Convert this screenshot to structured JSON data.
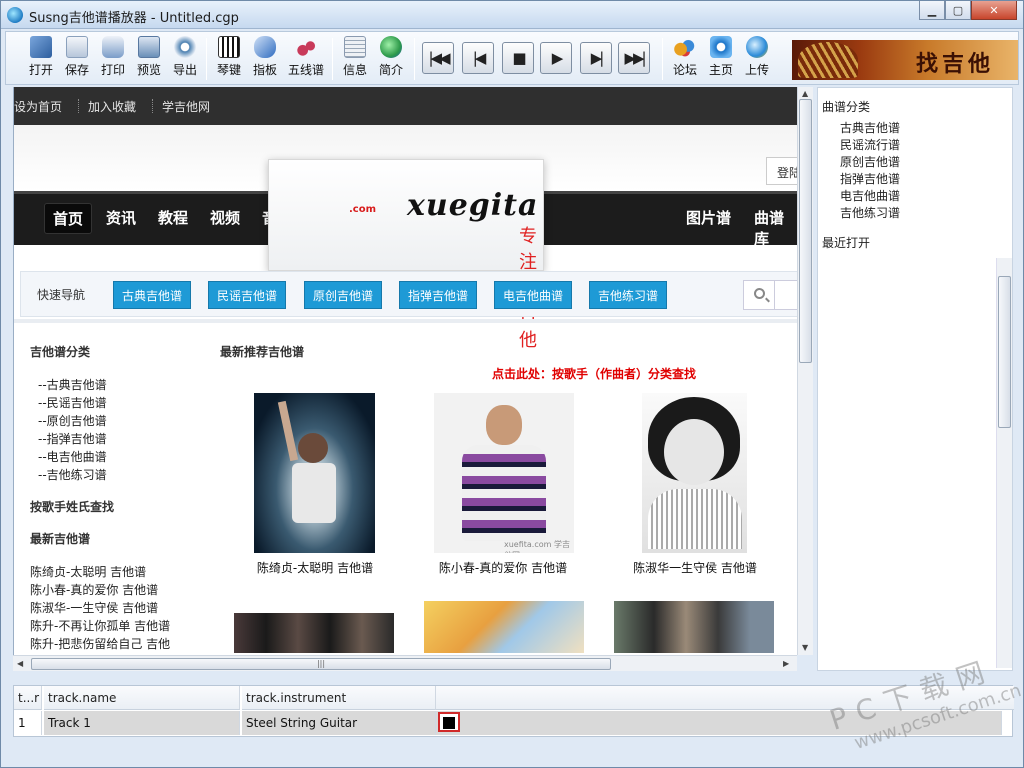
{
  "window": {
    "title": "Susng吉他谱播放器 - Untitled.cgp",
    "minimize": "▁",
    "maximize": "▢",
    "close": "✕"
  },
  "toolbar": {
    "buttons": [
      {
        "label": "打开",
        "icon": "open-folder-icon",
        "color": "#3c6fb0"
      },
      {
        "label": "保存",
        "icon": "save-icon",
        "color": "#9ab0cc"
      },
      {
        "label": "打印",
        "icon": "print-icon",
        "color": "#5d8cc0"
      },
      {
        "label": "预览",
        "icon": "preview-icon",
        "color": "#6a8fb8"
      },
      {
        "label": "导出",
        "icon": "export-icon",
        "color": "#4a7fb0"
      },
      {
        "label": "琴键",
        "icon": "piano-keys-icon",
        "color": "#222222"
      },
      {
        "label": "指板",
        "icon": "fretboard-icon",
        "color": "#3a78c8"
      },
      {
        "label": "五线谱",
        "icon": "staff-notes-icon",
        "color": "#c83a5a"
      },
      {
        "label": "信息",
        "icon": "info-doc-icon",
        "color": "#8a9ab0"
      },
      {
        "label": "简介",
        "icon": "intro-globe-icon",
        "color": "#2e9a4a"
      },
      {
        "label": "论坛",
        "icon": "forum-icon",
        "color": "#e8a020"
      },
      {
        "label": "主页",
        "icon": "ie-home-icon",
        "color": "#1a74c8"
      },
      {
        "label": "上传",
        "icon": "upload-globe-icon",
        "color": "#2a8ad8"
      }
    ],
    "playback": [
      {
        "name": "first-button",
        "glyph": "|◀◀"
      },
      {
        "name": "previous-button",
        "glyph": "|◀"
      },
      {
        "name": "stop-button",
        "glyph": "■"
      },
      {
        "name": "play-button",
        "glyph": "▶"
      },
      {
        "name": "next-button",
        "glyph": "▶|"
      },
      {
        "name": "last-button",
        "glyph": "▶▶|"
      }
    ],
    "banner_text": "找吉他谱"
  },
  "web": {
    "topnav": [
      "设为首页",
      "加入收藏",
      "学吉他网"
    ],
    "login": "登陆",
    "mainnav": [
      "首页",
      "资讯",
      "教程",
      "视频",
      "音乐",
      "图片谱",
      "曲谱库"
    ],
    "logo": {
      "text": "xuegita",
      "tld": ".com",
      "slogan": "专注学吉他"
    },
    "quicknav_label": "快速导航",
    "quicknav": [
      "古典吉他谱",
      "民谣吉他谱",
      "原创吉他谱",
      "指弹吉他谱",
      "电吉他曲谱",
      "吉他练习谱"
    ],
    "left": {
      "heading": "吉他谱分类",
      "categories": [
        "--古典吉他谱",
        "--民谣吉他谱",
        "--原创吉他谱",
        "--指弹吉他谱",
        "--电吉他曲谱",
        "--吉他练习谱"
      ],
      "singer_lookup": "按歌手姓氏查找",
      "latest_heading": "最新吉他谱",
      "latest": [
        "陈绮贞-太聪明 吉他谱",
        "陈小春-真的爱你 吉他谱",
        "陈淑华-一生守侯 吉他谱",
        "陈升-不再让你孤单 吉他谱",
        "陈升-把悲伤留给自己 吉他"
      ]
    },
    "recommend_heading": "最新推荐吉他谱",
    "red_link": "点击此处：按歌手（作曲者）分类查找",
    "photos": [
      "陈绮贞-太聪明 吉他谱",
      "陈小春-真的爱你 吉他谱",
      "陈淑华一生守侯 吉他谱"
    ],
    "watermark": "xuefita.com 学吉他网"
  },
  "sidebar": {
    "categories_heading": "曲谱分类",
    "categories": [
      "古典吉他谱",
      "民谣流行谱",
      "原创吉他谱",
      "指弹吉他谱",
      "电吉他曲谱",
      "吉他练习谱"
    ],
    "recent_heading": "最近打开"
  },
  "tracks": {
    "columns": [
      "t...r",
      "track.name",
      "track.instrument"
    ],
    "rows": [
      {
        "num": "1",
        "name": "Track 1",
        "instrument": "Steel String Guitar"
      }
    ]
  },
  "watermark": {
    "line1": "PC下载网",
    "line2": "www.pcsoft.com.cn"
  }
}
